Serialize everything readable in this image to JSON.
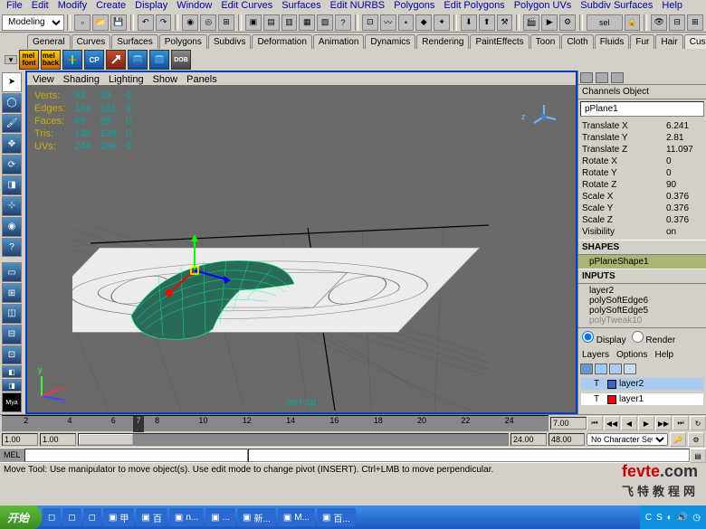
{
  "menubar": [
    "File",
    "Edit",
    "Modify",
    "Create",
    "Display",
    "Window",
    "Edit Curves",
    "Surfaces",
    "Edit NURBS",
    "Polygons",
    "Edit Polygons",
    "Polygon UVs",
    "Subdiv Surfaces",
    "Help"
  ],
  "mode_dropdown": "Modeling",
  "sel_label": "sel",
  "shelf_tabs": [
    "General",
    "Curves",
    "Surfaces",
    "Polygons",
    "Subdivs",
    "Deformation",
    "Animation",
    "Dynamics",
    "Rendering",
    "PaintEffects",
    "Toon",
    "Cloth",
    "Fluids",
    "Fur",
    "Hair",
    "Custom"
  ],
  "active_tab": "Custom",
  "shelf_icons": [
    {
      "name": "mel-front",
      "label": "mel\nfont"
    },
    {
      "name": "mel-back",
      "label": "mel\nback"
    },
    {
      "name": "cross-icon",
      "label": ""
    },
    {
      "name": "cp-icon",
      "label": "CP"
    },
    {
      "name": "arrow-icon",
      "label": ""
    },
    {
      "name": "cylinder-icon",
      "label": ""
    },
    {
      "name": "bluecyl-icon",
      "label": ""
    },
    {
      "name": "dob-icon",
      "label": "DOB"
    }
  ],
  "vp_menu": [
    "View",
    "Shading",
    "Lighting",
    "Show",
    "Panels"
  ],
  "hud": {
    "rows": [
      {
        "label": "Verts:",
        "a": "93",
        "b": "93",
        "c": "0"
      },
      {
        "label": "Edges:",
        "a": "161",
        "b": "161",
        "c": "0"
      },
      {
        "label": "Faces:",
        "a": "69",
        "b": "69",
        "c": "0"
      },
      {
        "label": "Tris:",
        "a": "138",
        "b": "138",
        "c": "0"
      },
      {
        "label": "UVs:",
        "a": "246",
        "b": "246",
        "c": "0"
      }
    ]
  },
  "camera_label": "persp",
  "axis": {
    "x": "x",
    "y": "y",
    "z": "z"
  },
  "compass_label": "z",
  "right": {
    "tabs": "Channels  Object",
    "object": "pPlane1",
    "attrs": [
      {
        "n": "Translate X",
        "v": "6.241"
      },
      {
        "n": "Translate Y",
        "v": "2.81"
      },
      {
        "n": "Translate Z",
        "v": "11.097"
      },
      {
        "n": "Rotate X",
        "v": "0"
      },
      {
        "n": "Rotate Y",
        "v": "0"
      },
      {
        "n": "Rotate Z",
        "v": "90"
      },
      {
        "n": "Scale X",
        "v": "0.376"
      },
      {
        "n": "Scale Y",
        "v": "0.376"
      },
      {
        "n": "Scale Z",
        "v": "0.376"
      },
      {
        "n": "Visibility",
        "v": "on"
      }
    ],
    "shapes_hdr": "SHAPES",
    "shape": "pPlaneShape1",
    "inputs_hdr": "INPUTS",
    "inputs": [
      "layer2",
      "polySoftEdge6",
      "polySoftEdge5",
      "polyTweak10"
    ],
    "display": "Display",
    "render": "Render",
    "layer_menu": [
      "Layers",
      "Options",
      "Help"
    ],
    "layers": [
      {
        "name": "layer2",
        "color": "#3a66cc",
        "sel": true
      },
      {
        "name": "layer1",
        "color": "#ff0000",
        "sel": false
      }
    ]
  },
  "timeline": {
    "ticks": [
      "2",
      "4",
      "6",
      "8",
      "10",
      "12",
      "14",
      "16",
      "18",
      "20",
      "22",
      "24"
    ],
    "current": "7",
    "end_field": "7.00"
  },
  "range": {
    "start": "1.00",
    "start2": "1.00",
    "end": "24.00",
    "end2": "48.00",
    "charset": "No Character Set"
  },
  "cmd": {
    "label": "MEL"
  },
  "helpline": "Move Tool: Use manipulator to move object(s). Use edit mode to change pivot (INSERT). Ctrl+LMB to move perpendicular.",
  "taskbar": {
    "start": "开始",
    "items": [
      "甲",
      "百",
      "n...",
      "...",
      "新...",
      "M...",
      "百..."
    ],
    "tray_time": ""
  },
  "watermark": {
    "brand": "fevte",
    "tld": ".com",
    "sub": "飞特教程网"
  }
}
